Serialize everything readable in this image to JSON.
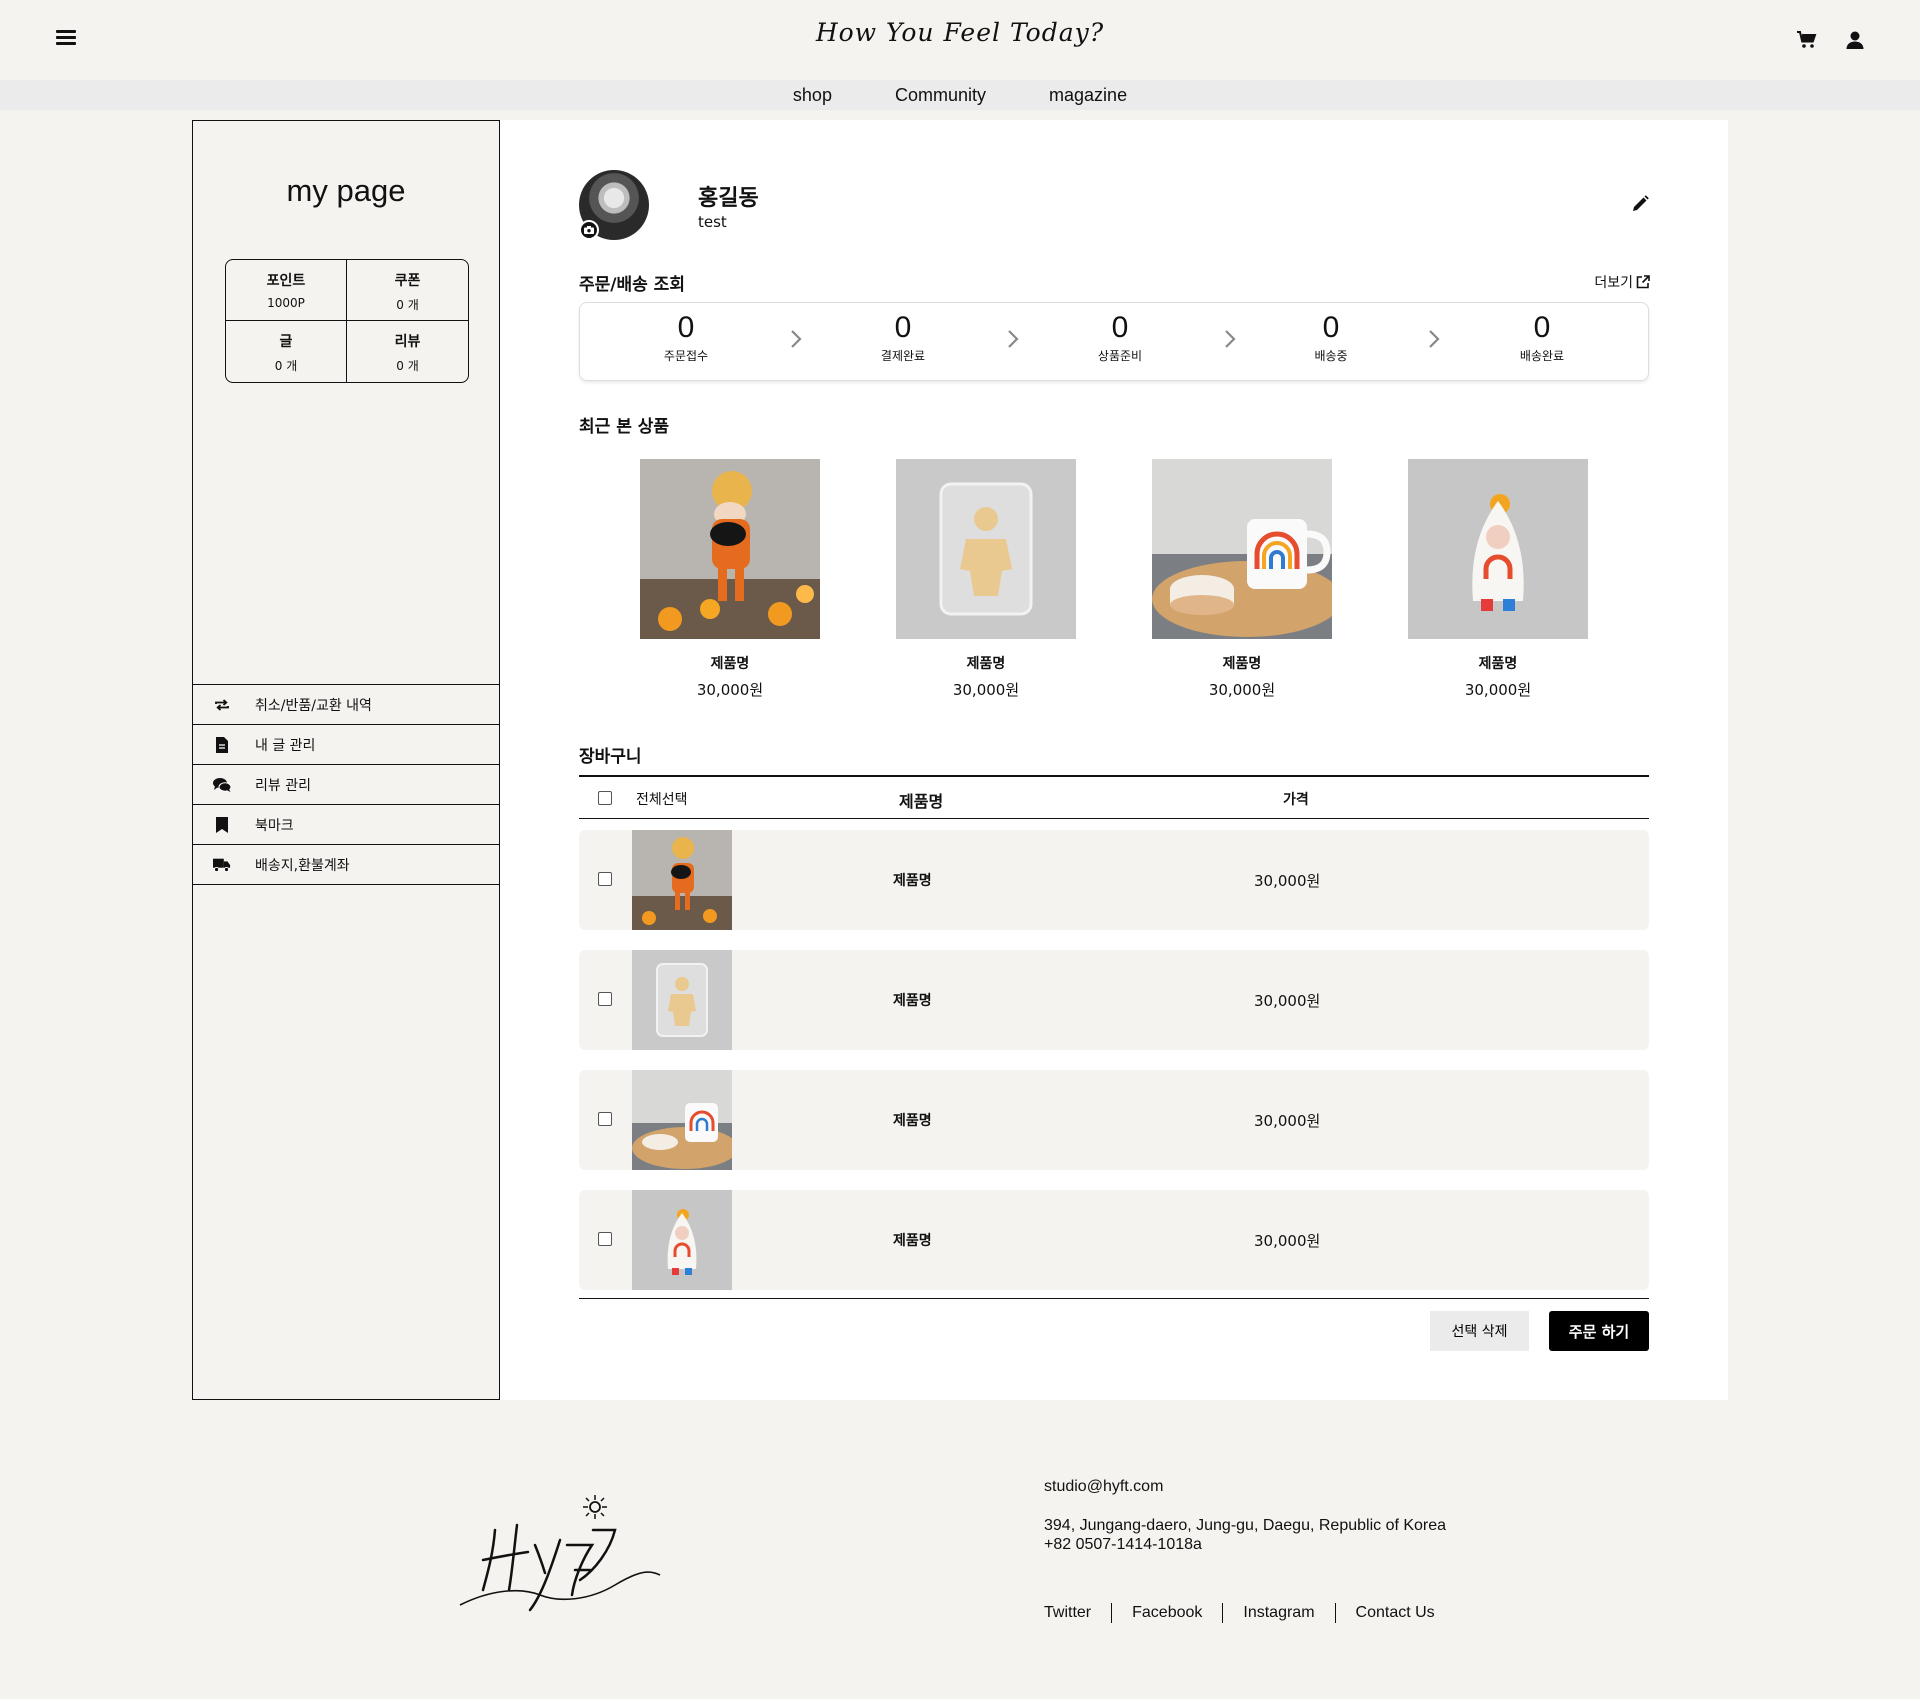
{
  "header": {
    "brand_script": "How You Feel Today?",
    "icons": [
      "menu-icon",
      "cart-icon",
      "user-icon"
    ]
  },
  "nav": {
    "items": [
      "shop",
      "Community",
      "magazine"
    ]
  },
  "sidebar": {
    "title": "my page",
    "stats": [
      {
        "label": "포인트",
        "value": "1000P"
      },
      {
        "label": "쿠폰",
        "value": "0 개"
      },
      {
        "label": "글",
        "value": "0 개"
      },
      {
        "label": "리뷰",
        "value": "0 개"
      }
    ],
    "menu": [
      {
        "label": "취소/반품/교환 내역",
        "icon": "exchange-icon"
      },
      {
        "label": "내 글 관리",
        "icon": "document-icon"
      },
      {
        "label": "리뷰 관리",
        "icon": "comments-icon"
      },
      {
        "label": "북마크",
        "icon": "bookmark-icon"
      },
      {
        "label": "배송지,환불계좌",
        "icon": "truck-icon"
      }
    ]
  },
  "profile": {
    "name": "홍길동",
    "sub": "test"
  },
  "orders": {
    "title": "주문/배송 조회",
    "more": "더보기",
    "steps": [
      {
        "count": "0",
        "label": "주문접수"
      },
      {
        "count": "0",
        "label": "결제완료"
      },
      {
        "count": "0",
        "label": "상품준비"
      },
      {
        "count": "0",
        "label": "배송중"
      },
      {
        "count": "0",
        "label": "배송완료"
      }
    ]
  },
  "recent": {
    "title": "최근 본 상품",
    "items": [
      {
        "name": "제품명",
        "price": "30,000원"
      },
      {
        "name": "제품명",
        "price": "30,000원"
      },
      {
        "name": "제품명",
        "price": "30,000원"
      },
      {
        "name": "제품명",
        "price": "30,000원"
      }
    ]
  },
  "cart": {
    "title": "장바구니",
    "select_all": "전체선택",
    "col_name": "제품명",
    "col_price": "가격",
    "rows": [
      {
        "name": "제품명",
        "price": "30,000원"
      },
      {
        "name": "제품명",
        "price": "30,000원"
      },
      {
        "name": "제품명",
        "price": "30,000원"
      },
      {
        "name": "제품명",
        "price": "30,000원"
      }
    ],
    "delete_label": "선택 삭제",
    "order_label": "주문 하기"
  },
  "footer": {
    "email": "studio@hyft.com",
    "address_line1": "394, Jungang-daero, Jung-gu, Daegu, Republic of Korea",
    "address_line2": "+82 0507-1414-1018a",
    "links": [
      "Twitter",
      "Facebook",
      "Instagram",
      "Contact Us"
    ]
  }
}
